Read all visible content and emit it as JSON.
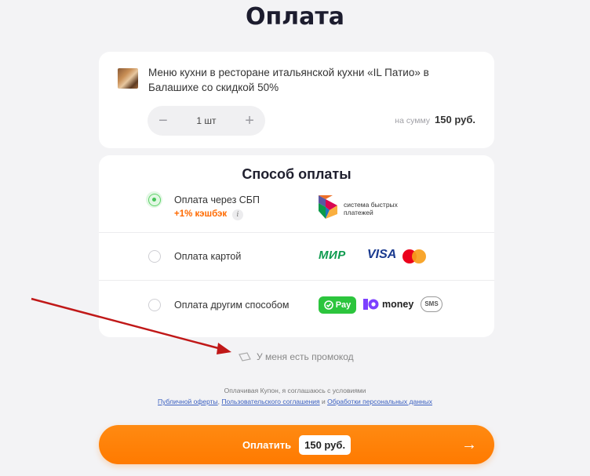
{
  "page": {
    "title": "Оплата"
  },
  "product": {
    "name": "Меню кухни в ресторане итальянской кухни «IL Патио» в Балашихе со скидкой 50%",
    "quantity": "1 шт",
    "minus": "−",
    "plus": "+",
    "sum_label": "на сумму",
    "sum_value": "150 руб."
  },
  "payment": {
    "title": "Способ оплаты",
    "options": [
      {
        "label": "Оплата через СБП",
        "cashback": "+1% кэшбэк",
        "info": "i",
        "selected": true,
        "logo_text": "система быстрых платежей"
      },
      {
        "label": "Оплата картой",
        "selected": false,
        "logos": [
          "МИР",
          "VISA",
          "mastercard"
        ]
      },
      {
        "label": "Оплата другим способом",
        "selected": false,
        "logos": [
          "Pay",
          "money",
          "SMS"
        ]
      }
    ]
  },
  "promo": {
    "label": "У меня есть промокод",
    "icon": "ticket-icon"
  },
  "terms": {
    "text": "Оплачивая Купон, я соглашаюсь с условиями",
    "link1": "Публичной оферты",
    "sep1": ", ",
    "link2": "Пользовательского соглашения",
    "sep2": " и ",
    "link3": "Обработки персональных данных"
  },
  "pay_button": {
    "label": "Оплатить",
    "price": "150 руб.",
    "arrow": "→"
  },
  "colors": {
    "accent": "#ff7a00",
    "green": "#45c458",
    "annotation": "#c01818"
  }
}
